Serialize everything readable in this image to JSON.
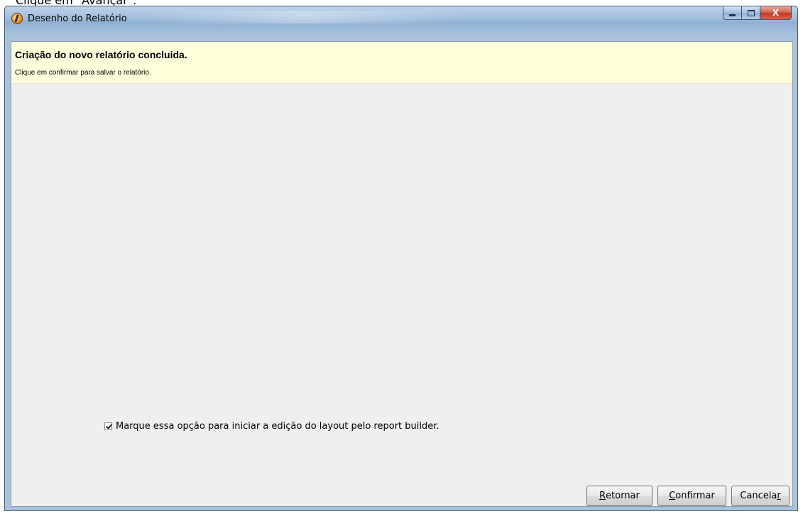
{
  "caption_text": "Clique em \"Avançar\".",
  "window": {
    "title": "Desenho do Relatório",
    "app_icon": "app-logo-icon",
    "controls": {
      "minimize_icon": "minimize-icon",
      "maximize_icon": "maximize-icon",
      "close_icon": "close-icon",
      "close_glyph": "X"
    }
  },
  "header": {
    "title": "Criação do novo relatório concluida.",
    "subtitle": "Clique em confirmar para salvar o relatório."
  },
  "option": {
    "label": "Marque essa opção para iniciar a edição do layout pelo report builder.",
    "checked": true
  },
  "buttons": {
    "retornar": {
      "mnemonic": "R",
      "rest": "etornar"
    },
    "confirmar": {
      "mnemonic": "C",
      "rest": "onfirmar"
    },
    "cancelar": {
      "prefix": "Cancela",
      "mnemonic": "r"
    }
  },
  "colors": {
    "header_background": "#ffffdc",
    "client_background": "#efefef",
    "titlebar": "#a9c2dc",
    "close_button": "#c2381f"
  }
}
